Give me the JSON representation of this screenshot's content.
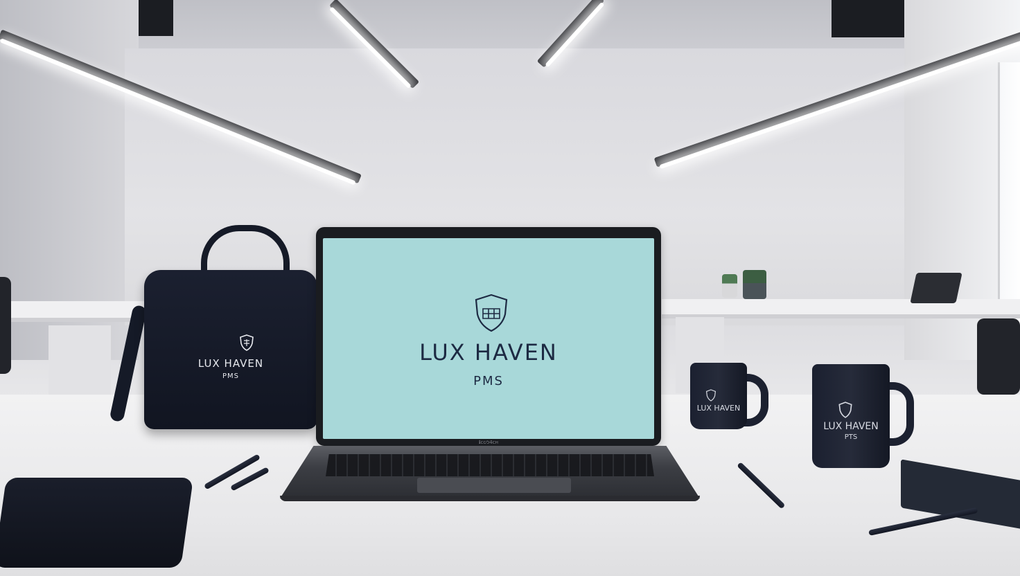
{
  "laptop_screen": {
    "brand_title": "LUX HAVEN",
    "brand_subtitle": "PMS",
    "background_color": "#a8d8d9",
    "logo_icon": "shield-crest-icon",
    "bezel_label": "ℹcc⁄ɔ4cʜ"
  },
  "bag": {
    "title": "LUX HAVEN",
    "subtitle": "PMS",
    "logo_icon": "shield-crest-icon"
  },
  "mug_left": {
    "title": "LUX HAVEN",
    "logo_icon": "shield-crest-icon"
  },
  "mug_right": {
    "title": "LUX HAVEN",
    "subtitle": "PTS",
    "logo_icon": "shield-crest-icon"
  },
  "colors": {
    "brand_navy": "#1d2a43",
    "merch_navy": "#1b2030"
  }
}
